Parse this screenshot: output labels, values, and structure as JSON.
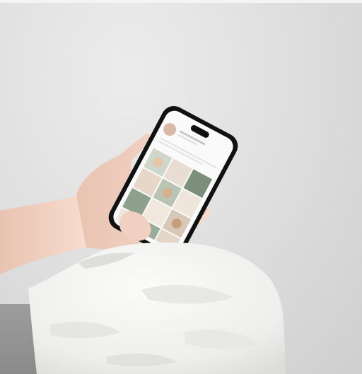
{
  "scene": {
    "description_label": "",
    "colors": {
      "wall": "#e3e3e3",
      "phone_frame": "#111111",
      "screen": "#fafafa",
      "accent_green": "#7b8f7a",
      "skin": "#f1d3c4",
      "rock": "#f2f2f0"
    }
  }
}
